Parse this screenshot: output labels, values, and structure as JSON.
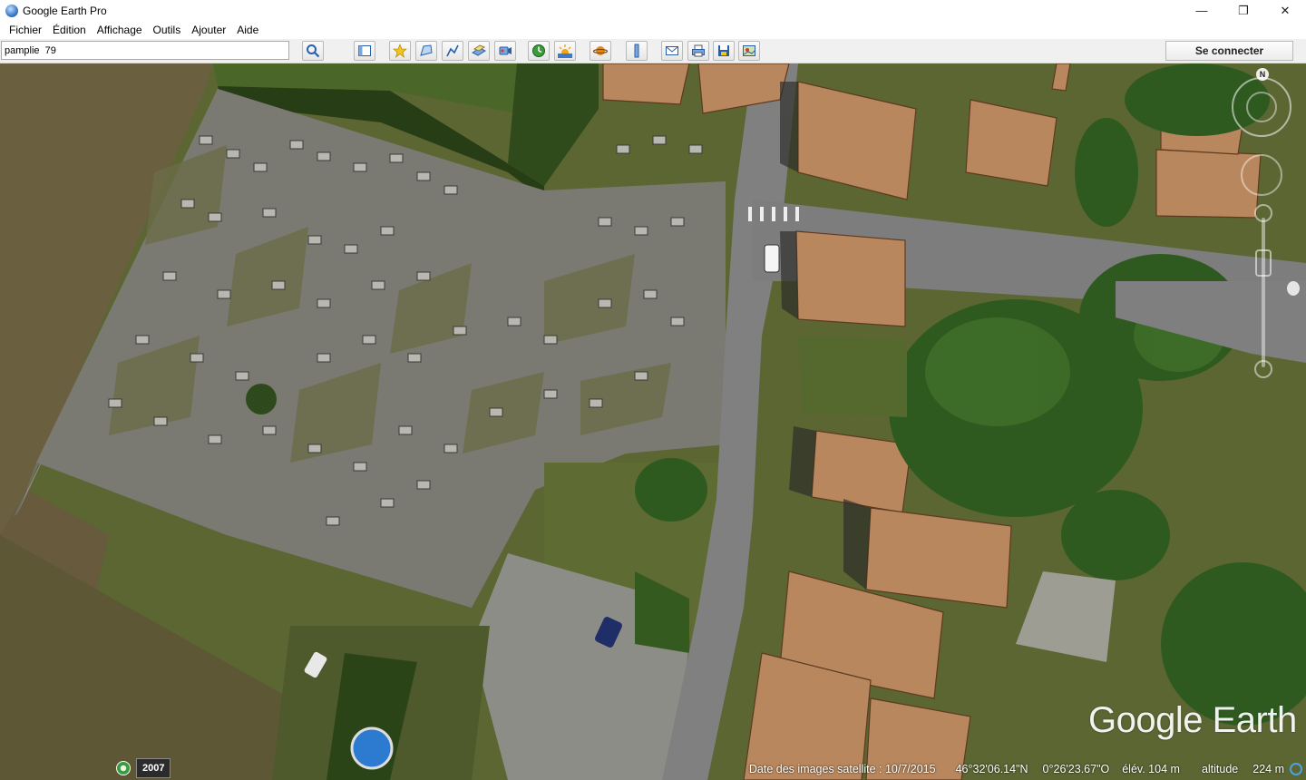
{
  "window": {
    "title": "Google Earth Pro",
    "controls": {
      "minimize": "—",
      "restore": "❐",
      "close": "✕"
    }
  },
  "menubar": {
    "items": [
      {
        "label": "Fichier"
      },
      {
        "label": "Édition"
      },
      {
        "label": "Affichage"
      },
      {
        "label": "Outils"
      },
      {
        "label": "Ajouter"
      },
      {
        "label": "Aide"
      }
    ]
  },
  "toolbar": {
    "search_value": "pamplie  79",
    "connect_label": "Se connecter",
    "buttons": [
      "search-icon",
      "sidebar-toggle-icon",
      "placemark-icon",
      "polygon-icon",
      "path-icon",
      "image-overlay-icon",
      "record-tour-icon",
      "historical-imagery-icon",
      "sunlight-icon",
      "planets-icon",
      "ruler-icon",
      "email-icon",
      "print-icon",
      "save-image-icon",
      "view-in-maps-icon"
    ]
  },
  "map": {
    "logo_text": "Google Earth",
    "compass_label": "N",
    "timeline_year": "2007",
    "status": {
      "imagery_date": "Date des images satellite : 10/7/2015",
      "latitude": "46°32'06.14\"N",
      "longitude": "0°26'23.67\"O",
      "elevation": "élév.  104 m",
      "altitude_label": "altitude",
      "altitude_value": "224 m"
    }
  }
}
